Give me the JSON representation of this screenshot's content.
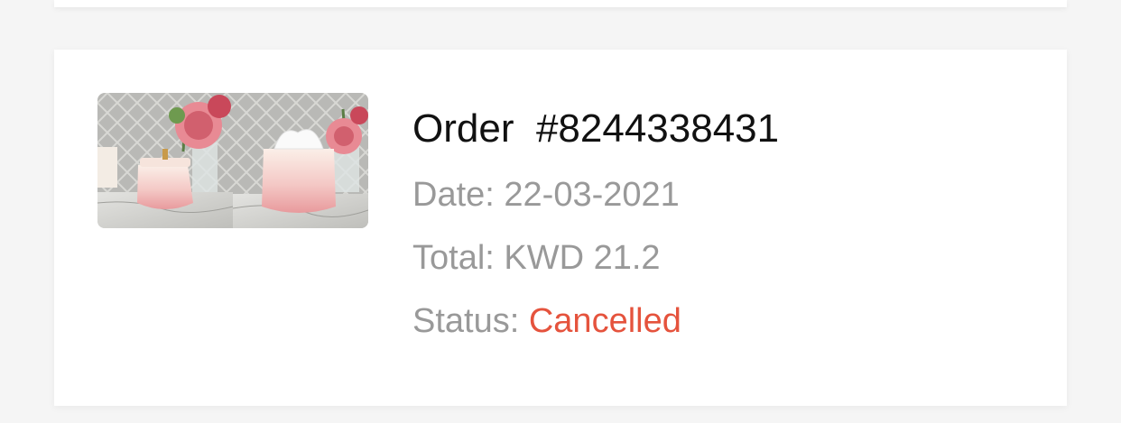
{
  "order": {
    "title_prefix": "Order",
    "number": "#8244338431",
    "date_label": "Date:",
    "date_value": "22-03-2021",
    "total_label": "Total:",
    "total_value": "KWD 21.2",
    "status_label": "Status:",
    "status_value": "Cancelled"
  },
  "colors": {
    "status_cancelled": "#e5533d",
    "label_gray": "#999999",
    "title": "#111111"
  },
  "image": {
    "icon": "product-thumbnail-icon"
  }
}
